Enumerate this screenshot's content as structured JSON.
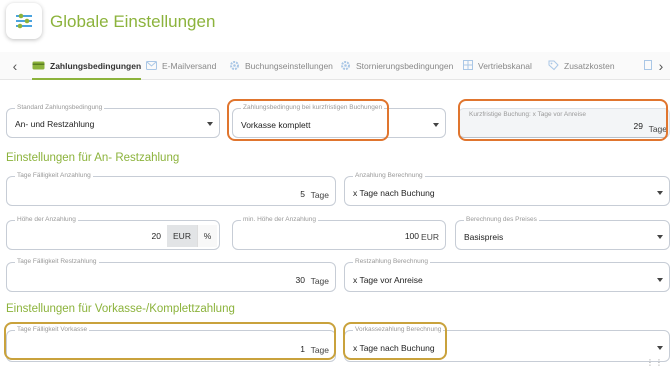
{
  "header": {
    "title": "Globale Einstellungen",
    "icon": "sliders-icon"
  },
  "tabs": [
    {
      "label": "Zahlungsbedingungen",
      "icon": "payment-icon",
      "active": true
    },
    {
      "label": "E-Mailversand",
      "icon": "mail-icon"
    },
    {
      "label": "Buchungseinstellungen",
      "icon": "gear-icon"
    },
    {
      "label": "Stornierungsbedingungen",
      "icon": "gear-icon"
    },
    {
      "label": "Vertriebskanal",
      "icon": "grid-icon"
    },
    {
      "label": "Zusatzkosten",
      "icon": "tag-icon"
    }
  ],
  "top_row": {
    "standard": {
      "label": "Standard Zahlungsbedingung",
      "value": "An- und Restzahlung"
    },
    "kurzfristig": {
      "label": "Zahlungsbedingung bei kurzfristigen Buchungen",
      "value": "Vorkasse komplett"
    },
    "tage_vor_anreise": {
      "label": "Kurzfristige Buchung: x Tage vor Anreise",
      "value": "29",
      "unit": "Tage"
    }
  },
  "section_anrest": {
    "title": "Einstellungen für An- Restzahlung",
    "tage_faelligkeit_anzahlung": {
      "label": "Tage Fälligkeit Anzahlung",
      "value": "5",
      "unit": "Tage"
    },
    "anzahlung_berechnung": {
      "label": "Anzahlung Berechnung",
      "value": "x Tage nach Buchung"
    },
    "hoehe_anzahlung": {
      "label": "Höhe der Anzahlung",
      "value": "20",
      "unit_eur": "EUR",
      "unit_pct": "%"
    },
    "min_hoehe_anzahlung": {
      "label": "min. Höhe der Anzahlung",
      "value": "100",
      "unit": "EUR"
    },
    "berechnung_preises": {
      "label": "Berechnung des Preises",
      "value": "Basispreis"
    },
    "tage_faelligkeit_rest": {
      "label": "Tage Fälligkeit Restzahlung",
      "value": "30",
      "unit": "Tage"
    },
    "restzahlung_berechnung": {
      "label": "Restzahlung Berechnung",
      "value": "x Tage vor Anreise"
    }
  },
  "section_vorkasse": {
    "title": "Einstellungen für Vorkasse-/Komplettzahlung",
    "tage_faelligkeit_vorkasse": {
      "label": "Tage Fälligkeit Vorkasse",
      "value": "1",
      "unit": "Tage"
    },
    "vorkasse_berechnung": {
      "label": "Vorkassezahlung Berechnung",
      "value": "x Tage nach Buchung"
    }
  },
  "colors": {
    "accent": "#8cb33c",
    "highlight_orange": "#e0752e",
    "highlight_gold": "#c9a23c"
  }
}
